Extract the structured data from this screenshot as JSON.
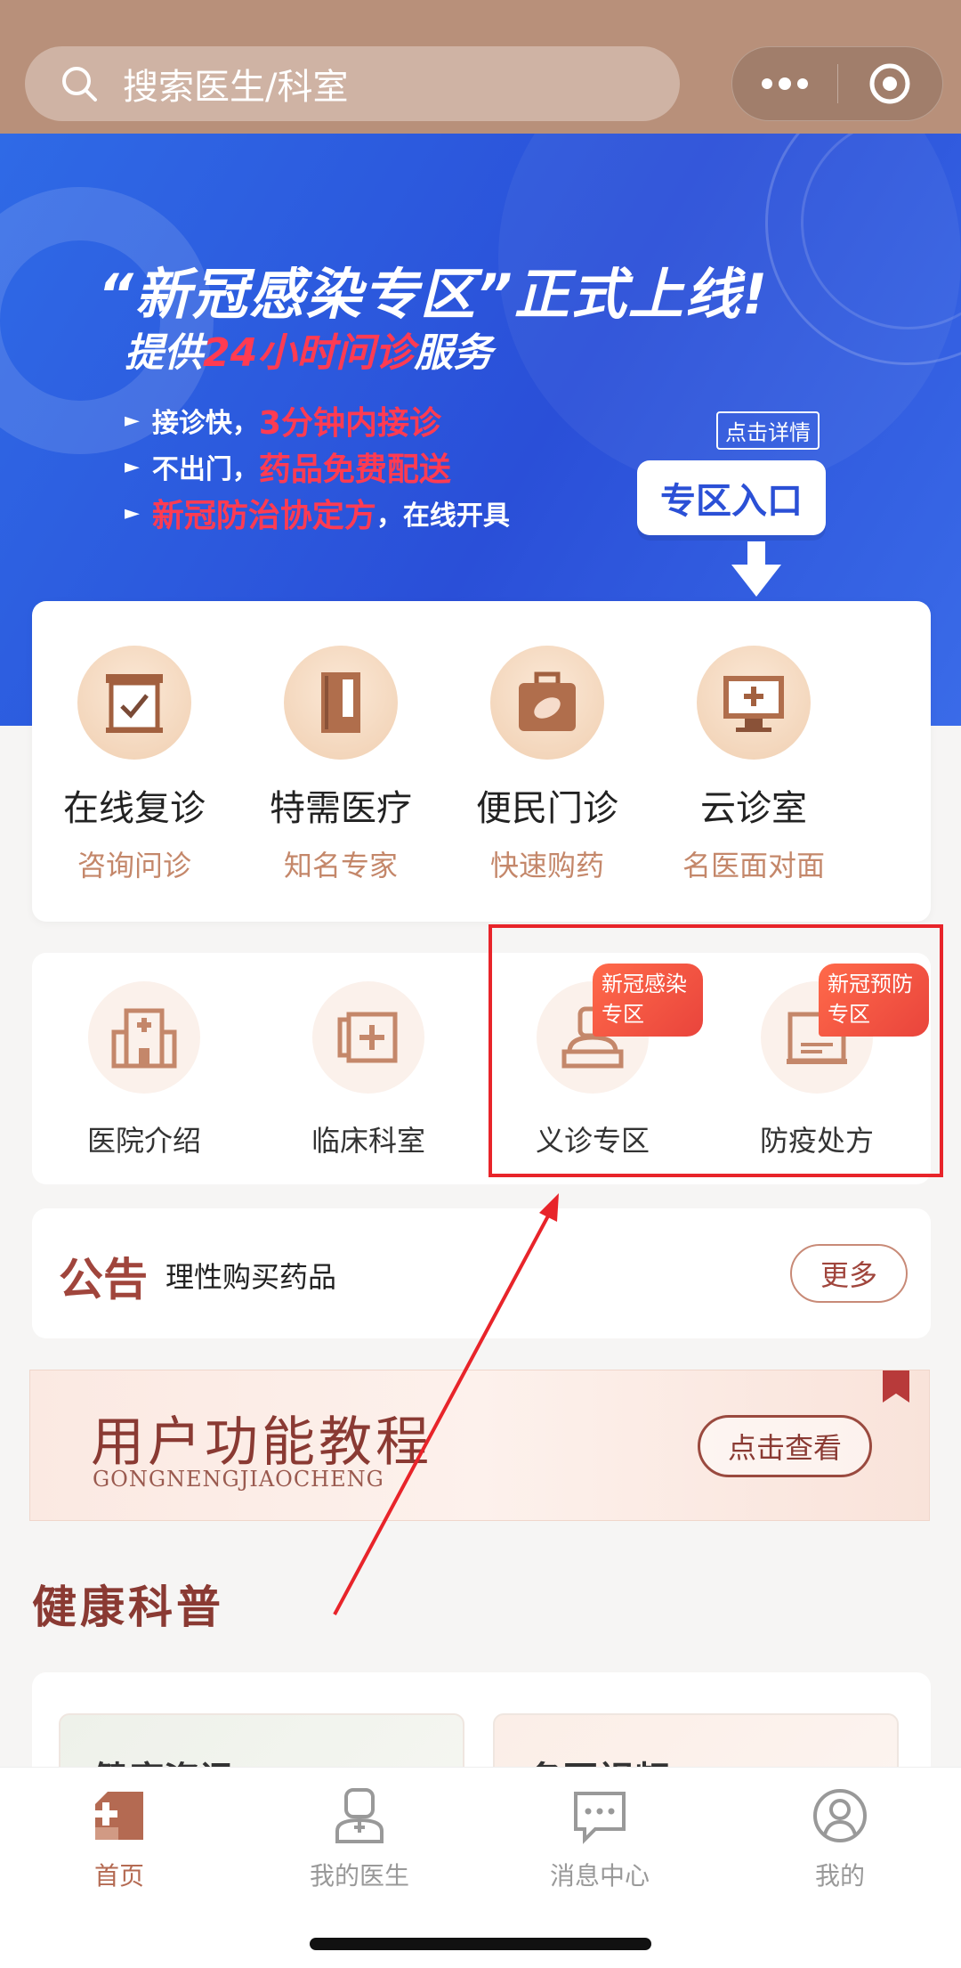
{
  "colors": {
    "topbar": "#b8907a",
    "accent": "#b46a52",
    "brand_dark": "#8a3a33",
    "banner_blue": "#2a4fd8",
    "highlight_red": "#e8242a",
    "badge_red": "#e9443c"
  },
  "search": {
    "placeholder": "搜索医生/科室",
    "icon": "search-icon"
  },
  "capsule": {
    "more_icon": "more-dots-icon",
    "close_icon": "target-icon"
  },
  "banner": {
    "headline": "“新冠感染专区”正式上线!",
    "sub_prefix": "提供",
    "sub_highlight": "24小时问诊",
    "sub_suffix": "服务",
    "bullets": [
      {
        "plain1": "接诊快，",
        "red": "3分钟内接诊",
        "plain2": ""
      },
      {
        "plain1": "不出门，",
        "red": "药品免费配送",
        "plain2": ""
      },
      {
        "plain1": "",
        "red": "新冠防治协定方",
        "plain2": "，在线开具"
      }
    ],
    "detail_tag": "点击详情",
    "entry_button": "专区入口"
  },
  "services": [
    {
      "title": "在线复诊",
      "subtitle": "咨询问诊",
      "icon": "checkbox-icon"
    },
    {
      "title": "特需医疗",
      "subtitle": "知名专家",
      "icon": "door-icon"
    },
    {
      "title": "便民门诊",
      "subtitle": "快速购药",
      "icon": "medicine-kit-icon"
    },
    {
      "title": "云诊室",
      "subtitle": "名医面对面",
      "icon": "monitor-cross-icon"
    }
  ],
  "departments": [
    {
      "title": "医院介绍",
      "icon": "hospital-icon"
    },
    {
      "title": "临床科室",
      "icon": "clinic-sign-icon"
    },
    {
      "title": "义诊专区",
      "icon": "doctor-desk-icon",
      "badge": [
        "新冠感染",
        "专区"
      ]
    },
    {
      "title": "防疫处方",
      "icon": "prescription-icon",
      "badge": [
        "新冠预防",
        "专区"
      ]
    }
  ],
  "notice": {
    "label": "公告",
    "text": "理性购买药品",
    "more": "更多"
  },
  "tutorial": {
    "title": "用户功能教程",
    "pinyin": "GONGNENGJIAOCHENG",
    "button": "点击查看"
  },
  "health": {
    "title": "健康科普",
    "cards": [
      "健康资讯",
      "名医视频"
    ]
  },
  "tabs": [
    {
      "label": "首页",
      "icon": "home-plus-icon",
      "active": true
    },
    {
      "label": "我的医生",
      "icon": "doctor-icon",
      "active": false
    },
    {
      "label": "消息中心",
      "icon": "message-icon",
      "active": false
    },
    {
      "label": "我的",
      "icon": "user-icon",
      "active": false
    }
  ]
}
